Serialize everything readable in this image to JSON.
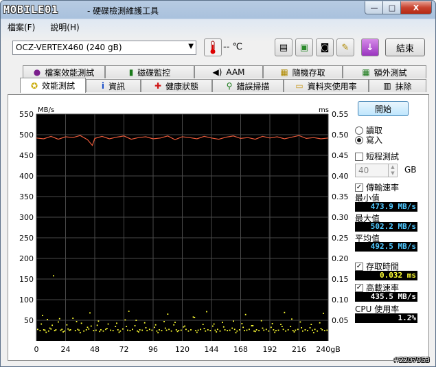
{
  "window": {
    "logo": "MOBILE01",
    "title": "- 硬碟檢測維護工具",
    "buttons": {
      "minimize": "—",
      "maximize": "□",
      "close": "X"
    }
  },
  "menu": [
    "檔案(F)",
    "說明(H)"
  ],
  "toolbar": {
    "drive": "OCZ-VERTEX460 (240 gB)",
    "temperature": "-- ℃",
    "exit_label": "結束",
    "icons": [
      "copy-text-icon",
      "copy-screenshot-icon",
      "camera-icon",
      "wrench-icon",
      "download-icon"
    ]
  },
  "tabs_top": [
    {
      "label": "檔案效能測試",
      "icon": "file-benchmark-icon"
    },
    {
      "label": "磁碟監控",
      "icon": "disk-monitor-icon"
    },
    {
      "label": "AAM",
      "icon": "speaker-icon"
    },
    {
      "label": "隨機存取",
      "icon": "random-access-icon"
    },
    {
      "label": "額外測試",
      "icon": "extra-tests-icon"
    }
  ],
  "tabs_bottom": [
    {
      "label": "效能測試",
      "icon": "lightbulb-icon",
      "selected": true
    },
    {
      "label": "資訊",
      "icon": "info-icon"
    },
    {
      "label": "健康狀態",
      "icon": "health-cross-icon"
    },
    {
      "label": "錯誤掃描",
      "icon": "magnifier-icon"
    },
    {
      "label": "資料夾使用率",
      "icon": "folder-icon"
    },
    {
      "label": "抹除",
      "icon": "trash-icon"
    }
  ],
  "side": {
    "start_label": "開始",
    "read_label": "讀取",
    "write_label": "寫入",
    "mode": "write",
    "short_test_label": "短程測試",
    "short_test_checked": false,
    "short_test_value": "40",
    "gb_label": "GB",
    "transfer_rate_label": "傳輸速率",
    "transfer_rate_checked": true,
    "min_label": "最小值",
    "min_value": "473.9 MB/s",
    "max_label": "最大值",
    "max_value": "502.2 MB/s",
    "avg_label": "平均值",
    "avg_value": "492.5 MB/s",
    "access_time_label": "存取時間",
    "access_time_checked": true,
    "access_time_value": "0.032 ms",
    "burst_rate_label": "高載速率",
    "burst_rate_checked": true,
    "burst_rate_value": "435.5 MB/s",
    "cpu_label": "CPU 使用率",
    "cpu_value": "1.2%"
  },
  "watermark": "#2207953",
  "colors": {
    "chart_bg": "#000000",
    "grid": "#4a4a4a",
    "write_line": "#e85a3a",
    "access_points": "#ffff33",
    "value_text": "#4fc8ff"
  },
  "chart_data": {
    "type": "line",
    "ylabel": "MB/s",
    "y2label": "ms",
    "ylim": [
      0,
      550
    ],
    "y_ticks": [
      50,
      100,
      150,
      200,
      250,
      300,
      350,
      400,
      450,
      500,
      550
    ],
    "y2lim": [
      0,
      0.55
    ],
    "y2_ticks": [
      "0.05",
      "0.10",
      "0.15",
      "0.20",
      "0.25",
      "0.30",
      "0.35",
      "0.40",
      "0.45",
      "0.50",
      "0.55"
    ],
    "xlim": [
      0,
      240
    ],
    "x_ticks": [
      "0",
      "24",
      "48",
      "72",
      "96",
      "120",
      "144",
      "168",
      "192",
      "216",
      "240gB"
    ],
    "grid": true,
    "series": [
      {
        "kind": "transfer-rate-line",
        "x": [
          0,
          6,
          12,
          18,
          24,
          30,
          36,
          42,
          46,
          48,
          54,
          60,
          66,
          72,
          78,
          84,
          90,
          96,
          102,
          108,
          114,
          120,
          126,
          132,
          138,
          144,
          150,
          156,
          162,
          168,
          174,
          180,
          186,
          192,
          198,
          204,
          210,
          216,
          222,
          228,
          234,
          240
        ],
        "values": [
          492,
          490,
          496,
          489,
          495,
          493,
          498,
          488,
          474,
          491,
          496,
          490,
          494,
          497,
          489,
          493,
          495,
          490,
          492,
          497,
          488,
          495,
          493,
          490,
          496,
          492,
          489,
          494,
          497,
          491,
          493,
          489,
          496,
          492,
          495,
          490,
          494,
          498,
          491,
          493,
          490,
          492
        ]
      },
      {
        "kind": "access-time-scatter",
        "x": [
          1,
          3,
          4,
          6,
          7,
          9,
          10,
          12,
          13,
          15,
          16,
          18,
          20,
          21,
          23,
          25,
          27,
          28,
          30,
          32,
          34,
          35,
          37,
          39,
          41,
          43,
          45,
          47,
          49,
          51,
          53,
          55,
          57,
          59,
          61,
          63,
          65,
          67,
          69,
          71,
          73,
          75,
          77,
          79,
          81,
          83,
          85,
          87,
          89,
          91,
          93,
          95,
          97,
          99,
          101,
          103,
          105,
          107,
          109,
          111,
          113,
          115,
          117,
          119,
          121,
          123,
          125,
          127,
          129,
          131,
          133,
          135,
          137,
          139,
          141,
          143,
          145,
          147,
          149,
          151,
          153,
          155,
          157,
          159,
          161,
          163,
          165,
          167,
          169,
          171,
          173,
          175,
          177,
          179,
          181,
          183,
          185,
          187,
          189,
          191,
          193,
          195,
          197,
          199,
          201,
          203,
          205,
          207,
          209,
          211,
          213,
          215,
          217,
          219,
          221,
          223,
          225,
          227,
          229,
          231,
          233,
          235,
          237,
          239,
          5,
          11,
          19,
          26,
          33,
          42,
          50,
          58,
          66,
          74,
          82,
          90,
          98,
          106,
          114,
          122,
          130,
          138,
          146,
          154,
          162,
          170,
          178,
          186,
          194,
          202,
          210,
          218,
          226,
          234,
          8,
          22,
          36,
          52,
          68,
          84,
          100,
          116,
          132,
          148,
          164,
          180,
          196,
          212,
          228,
          14,
          44,
          76,
          108,
          140,
          172,
          204,
          236
        ],
        "values": [
          0.028,
          0.025,
          0.041,
          0.027,
          0.026,
          0.052,
          0.024,
          0.029,
          0.038,
          0.025,
          0.027,
          0.046,
          0.026,
          0.028,
          0.024,
          0.039,
          0.026,
          0.027,
          0.055,
          0.025,
          0.028,
          0.026,
          0.043,
          0.024,
          0.027,
          0.029,
          0.036,
          0.025,
          0.026,
          0.048,
          0.027,
          0.024,
          0.028,
          0.041,
          0.026,
          0.025,
          0.035,
          0.027,
          0.024,
          0.029,
          0.051,
          0.026,
          0.025,
          0.028,
          0.037,
          0.024,
          0.027,
          0.026,
          0.044,
          0.025,
          0.028,
          0.026,
          0.033,
          0.024,
          0.027,
          0.025,
          0.047,
          0.026,
          0.028,
          0.024,
          0.039,
          0.027,
          0.025,
          0.026,
          0.034,
          0.028,
          0.024,
          0.027,
          0.058,
          0.025,
          0.026,
          0.028,
          0.04,
          0.024,
          0.027,
          0.025,
          0.036,
          0.026,
          0.028,
          0.024,
          0.045,
          0.027,
          0.025,
          0.026,
          0.031,
          0.028,
          0.024,
          0.027,
          0.042,
          0.025,
          0.026,
          0.028,
          0.037,
          0.024,
          0.027,
          0.025,
          0.049,
          0.026,
          0.028,
          0.024,
          0.033,
          0.027,
          0.025,
          0.026,
          0.04,
          0.028,
          0.024,
          0.027,
          0.035,
          0.025,
          0.026,
          0.028,
          0.046,
          0.024,
          0.027,
          0.025,
          0.032,
          0.026,
          0.028,
          0.024,
          0.044,
          0.027,
          0.025,
          0.026,
          0.062,
          0.031,
          0.054,
          0.029,
          0.047,
          0.033,
          0.038,
          0.03,
          0.043,
          0.035,
          0.05,
          0.032,
          0.039,
          0.031,
          0.045,
          0.036,
          0.057,
          0.03,
          0.041,
          0.034,
          0.048,
          0.033,
          0.037,
          0.031,
          0.042,
          0.035,
          0.053,
          0.032,
          0.04,
          0.03,
          0.021,
          0.022,
          0.02,
          0.023,
          0.021,
          0.022,
          0.02,
          0.023,
          0.021,
          0.022,
          0.02,
          0.023,
          0.021,
          0.022,
          0.02,
          0.158,
          0.068,
          0.072,
          0.065,
          0.071,
          0.064,
          0.069,
          0.067
        ]
      }
    ]
  }
}
